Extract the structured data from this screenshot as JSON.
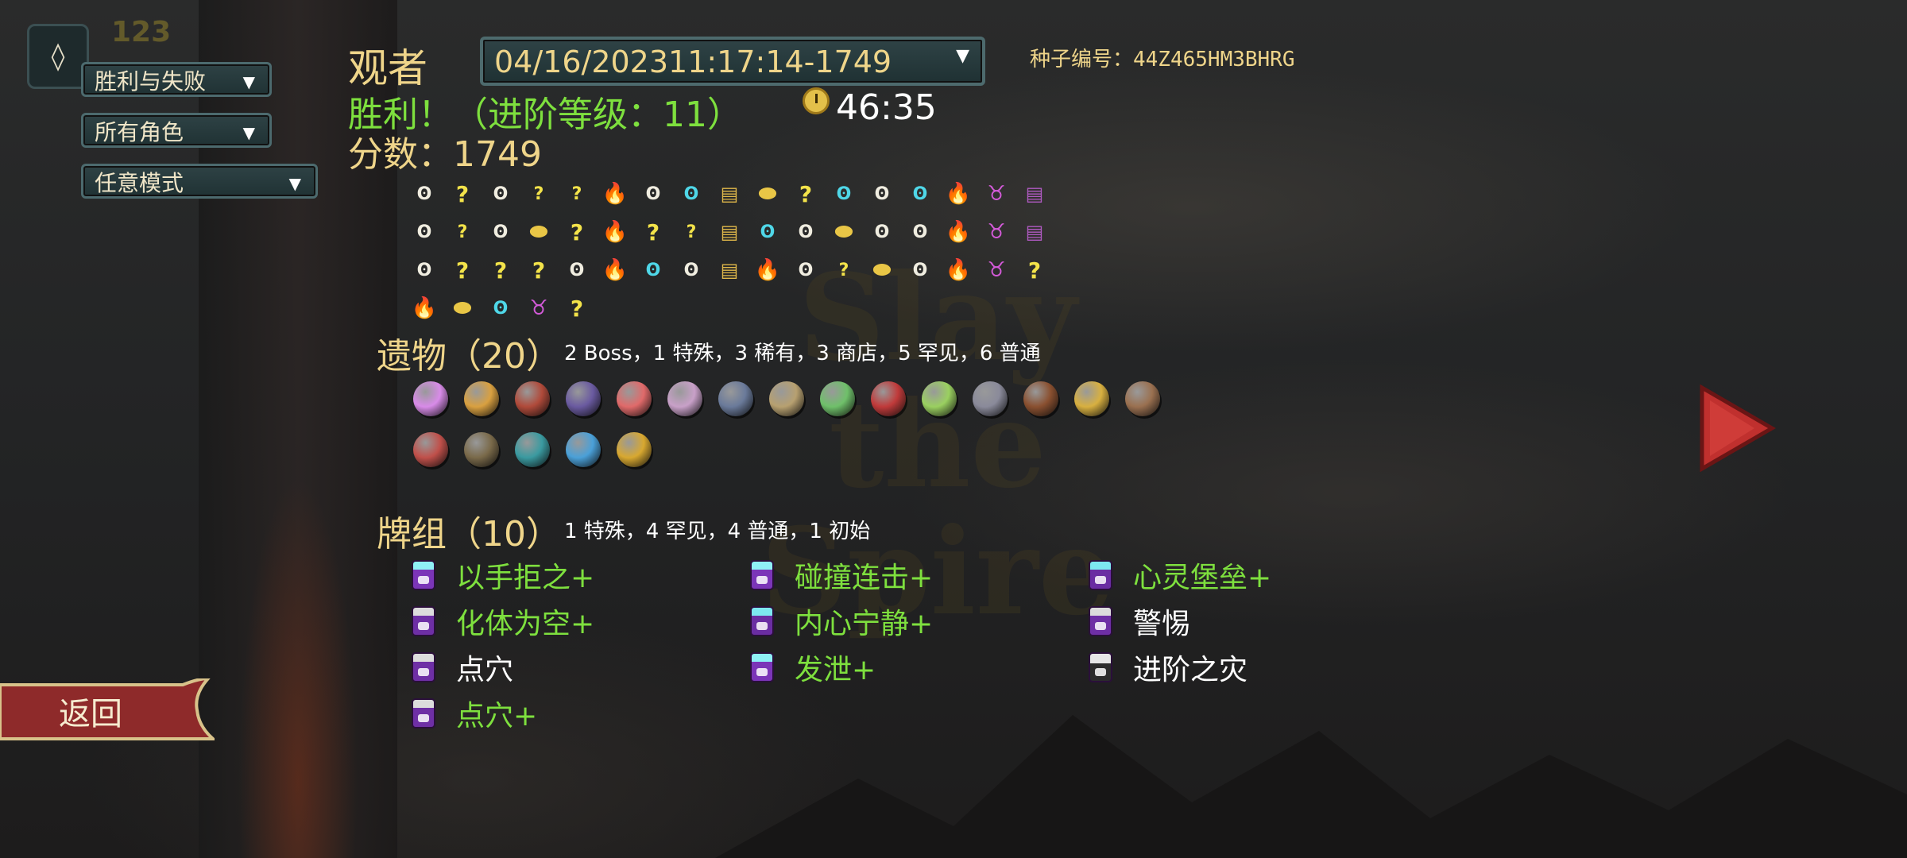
{
  "top_left": {
    "gem_icon": "ascension-gem-icon",
    "gem_count": "123"
  },
  "filters": [
    {
      "label": "胜利与失败"
    },
    {
      "label": "所有角色"
    },
    {
      "label": "任意模式"
    }
  ],
  "header": {
    "character": "观者",
    "run_selector": "04/16/202311:17:14-1749",
    "seed_label": "种子编号：44Z465HM3BHRG",
    "result": "胜利！（进阶等级：11）",
    "time": "46:35",
    "score": "分数：1749"
  },
  "watermark": {
    "line1": "Slay the",
    "line2": "Spire"
  },
  "path": {
    "rows": [
      [
        "monster",
        "unknown",
        "monster",
        "unknown-treasure",
        "unknown-monster",
        "rest",
        "monster",
        "elite",
        "treasure",
        "shop",
        "unknown",
        "elite",
        "monster",
        "elite",
        "rest",
        "boss",
        "boss-chest"
      ],
      [
        "monster",
        "unknown-monster",
        "monster",
        "shop",
        "unknown",
        "rest",
        "unknown",
        "unknown-treasure",
        "treasure",
        "elite",
        "monster",
        "shop",
        "monster",
        "monster",
        "rest",
        "boss",
        "boss-chest"
      ],
      [
        "monster",
        "unknown",
        "unknown",
        "unknown",
        "monster",
        "rest",
        "elite",
        "monster",
        "treasure",
        "rest",
        "monster",
        "unknown-monster",
        "shop",
        "monster",
        "rest",
        "boss",
        "unknown"
      ],
      [
        "rest",
        "shop",
        "elite",
        "boss",
        "unknown"
      ]
    ],
    "legend": {
      "monster": "ʘ",
      "unknown": "?",
      "rest": "🔥",
      "elite": "ʘ",
      "boss": "♉",
      "treasure": "▤",
      "shop": "⬬",
      "boss-chest": "▤",
      "unknown-treasure": "?",
      "unknown-monster": "?"
    }
  },
  "relics": {
    "heading": "遗物（20）",
    "summary": "2  Boss，1  特殊，3  稀有，3  商店，5  罕见，6  普通",
    "row1": [
      {
        "name": "pure-water-icon",
        "color": "#d88be8"
      },
      {
        "name": "potted-plant-icon",
        "color": "#d9a040"
      },
      {
        "name": "meat-on-bone-icon",
        "color": "#b04a3a"
      },
      {
        "name": "bag-of-marbles-icon",
        "color": "#6a5aa0"
      },
      {
        "name": "lunch-box-icon",
        "color": "#e06a6a"
      },
      {
        "name": "turnip-icon",
        "color": "#c8a0c8"
      },
      {
        "name": "anchor-icon",
        "color": "#6a7a9a"
      },
      {
        "name": "birdcage-icon",
        "color": "#b7a070"
      },
      {
        "name": "scroll-icon",
        "color": "#6fc06a"
      },
      {
        "name": "red-starfish-icon",
        "color": "#c03a3a"
      },
      {
        "name": "green-ingot-icon",
        "color": "#9ad060"
      },
      {
        "name": "mouse-icon",
        "color": "#8a8a9a"
      },
      {
        "name": "abacus-icon",
        "color": "#8a5030"
      },
      {
        "name": "golden-egg-icon",
        "color": "#d8b040"
      },
      {
        "name": "mortar-bowl-icon",
        "color": "#9a7050"
      }
    ],
    "row2": [
      {
        "name": "demon-hand-icon",
        "color": "#c0504a"
      },
      {
        "name": "book-icon",
        "color": "#7a6a4a"
      },
      {
        "name": "teal-slipper-icon",
        "color": "#3a9aa0"
      },
      {
        "name": "blue-flask-icon",
        "color": "#4aa0d8"
      },
      {
        "name": "golden-crystal-icon",
        "color": "#d8a830"
      }
    ]
  },
  "deck": {
    "heading": "牌组（10）",
    "summary": "1  特殊，4  罕见，4  普通，1  初始",
    "cards": [
      {
        "label": "以手拒之+",
        "upgraded": true,
        "type": "att"
      },
      {
        "label": "化体为空+",
        "upgraded": true,
        "type": "skill"
      },
      {
        "label": "点穴",
        "upgraded": false,
        "type": "skill"
      },
      {
        "label": "点穴+",
        "upgraded": true,
        "type": "skill"
      },
      {
        "label": "碰撞连击+",
        "upgraded": true,
        "type": "att"
      },
      {
        "label": "内心宁静+",
        "upgraded": true,
        "type": "pow"
      },
      {
        "label": "发泄+",
        "upgraded": true,
        "type": "att"
      },
      {
        "label": "心灵堡垒+",
        "upgraded": true,
        "type": "pow"
      },
      {
        "label": "警惕",
        "upgraded": false,
        "type": "skill"
      },
      {
        "label": "进阶之灾",
        "upgraded": false,
        "type": "curse"
      }
    ]
  },
  "buttons": {
    "back": "返回",
    "next_icon": "next-arrow-icon"
  },
  "colors": {
    "gold": "#efd58a",
    "upgrade_green": "#7ee03e",
    "panel_teal": "#2e4245"
  }
}
